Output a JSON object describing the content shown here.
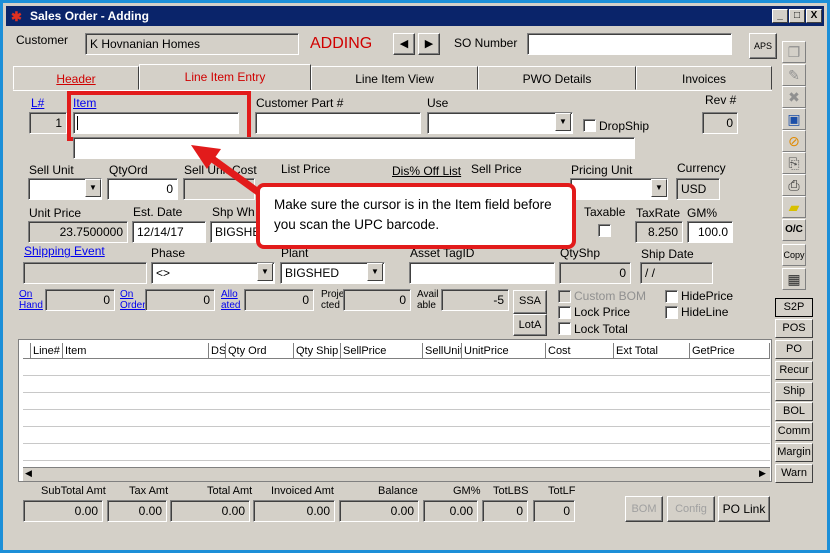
{
  "window": {
    "title": "Sales Order - Adding",
    "minimize": "_",
    "maximize": "□",
    "close": "X"
  },
  "header": {
    "customer_label": "Customer",
    "customer_value": "K Hovnanian Homes",
    "mode": "ADDING",
    "so_label": "SO Number",
    "so_value": "",
    "aps_label": "APS"
  },
  "tabs": [
    {
      "label": "Header"
    },
    {
      "label": "Line Item Entry"
    },
    {
      "label": "Line Item View"
    },
    {
      "label": "PWO Details"
    },
    {
      "label": "Invoices"
    }
  ],
  "line": {
    "lnum_label": "L#",
    "lnum_value": "1",
    "item_label": "Item",
    "item_value": "",
    "cust_part_label": "Customer Part #",
    "cust_part_value": "",
    "use_label": "Use",
    "use_value": "",
    "dropship_label": "DropShip",
    "rev_label": "Rev #",
    "rev_value": "0",
    "description_value": "",
    "sell_unit_label": "Sell Unit",
    "sell_unit_value": "",
    "qty_ord_label": "QtyOrd",
    "qty_ord_value": "0",
    "sell_unit_cost_label": "Sell Unit Cost",
    "sell_unit_cost_value": "",
    "list_price_label": "List Price",
    "list_price_value": "",
    "dis_off_list_label": "Dis% Off List",
    "dis_off_list_value": "",
    "sell_price_label": "Sell Price",
    "sell_price_value": "",
    "pricing_unit_label": "Pricing Unit",
    "pricing_unit_value": "",
    "currency_label": "Currency",
    "currency_value": "USD",
    "unit_price_label": "Unit Price",
    "unit_price_value": "23.7500000",
    "est_date_label": "Est. Date",
    "est_date_value": "12/14/17",
    "ship_wh_label": "Shp Wh",
    "ship_wh_value": "BIGSHED",
    "taxable_label": "Taxable",
    "tax_rate_label": "TaxRate",
    "tax_rate_value": "8.250",
    "gm_label": "GM%",
    "gm_value": "100.0",
    "shipping_event_label": "Shipping Event",
    "shipping_event_value": "",
    "phase_label": "Phase",
    "phase_value": "<>",
    "plant_label": "Plant",
    "plant_value": "BIGSHED",
    "asset_tag_label": "Asset TagID",
    "asset_tag_value": "",
    "qty_shp_label": "QtyShp",
    "qty_shp_value": "0",
    "ship_date_label": "Ship Date",
    "ship_date_value": "/ /",
    "on_hand_label_1": "On",
    "on_hand_label_2": "Hand",
    "on_hand_value": "0",
    "on_order_label_1": "On",
    "on_order_label_2": "Order",
    "on_order_value": "0",
    "allocated_label_1": "Allo",
    "allocated_label_2": "ated",
    "allocated_value": "0",
    "projected_label_1": "Proje",
    "projected_label_2": "cted",
    "projected_value": "0",
    "available_label_1": "Avail",
    "available_label_2": "able",
    "available_value": "-5",
    "ssa_label": "SSA",
    "lota_label": "LotA",
    "custom_bom_label": "Custom BOM",
    "lock_price_label": "Lock Price",
    "lock_total_label": "Lock Total",
    "hide_price_label": "HidePrice",
    "hide_line_label": "HideLine"
  },
  "grid": {
    "columns": [
      "Line#",
      "Item",
      "DS",
      "Qty Ord",
      "Qty Ship",
      "SellPrice",
      "SellUnit",
      "UnitPrice",
      "Cost",
      "Ext Total",
      "GetPrice"
    ]
  },
  "totals": {
    "subtotal_label": "SubTotal Amt",
    "subtotal_value": "0.00",
    "tax_label": "Tax Amt",
    "tax_value": "0.00",
    "total_label": "Total Amt",
    "total_value": "0.00",
    "invoiced_label": "Invoiced Amt",
    "invoiced_value": "0.00",
    "balance_label": "Balance",
    "balance_value": "0.00",
    "gm_label": "GM%",
    "gm_value": "0.00",
    "totlbs_label": "TotLBS",
    "totlbs_value": "0",
    "totlf_label": "TotLF",
    "totlf_value": "0",
    "bom_label": "BOM",
    "config_label": "Config",
    "polink_label": "PO Link"
  },
  "sidebar": {
    "o_c": "O/C",
    "copy": "Copy",
    "buttons": [
      "S2P",
      "POS",
      "PO",
      "Recur",
      "Ship",
      "BOL",
      "Comm",
      "Margin",
      "Warn"
    ]
  },
  "callout": {
    "text": "Make sure the cursor is in the Item field before you scan the UPC barcode."
  },
  "colors": {
    "annotation": "#e21b1b",
    "titlebar": "#0a246a",
    "mode": "#d00000"
  }
}
